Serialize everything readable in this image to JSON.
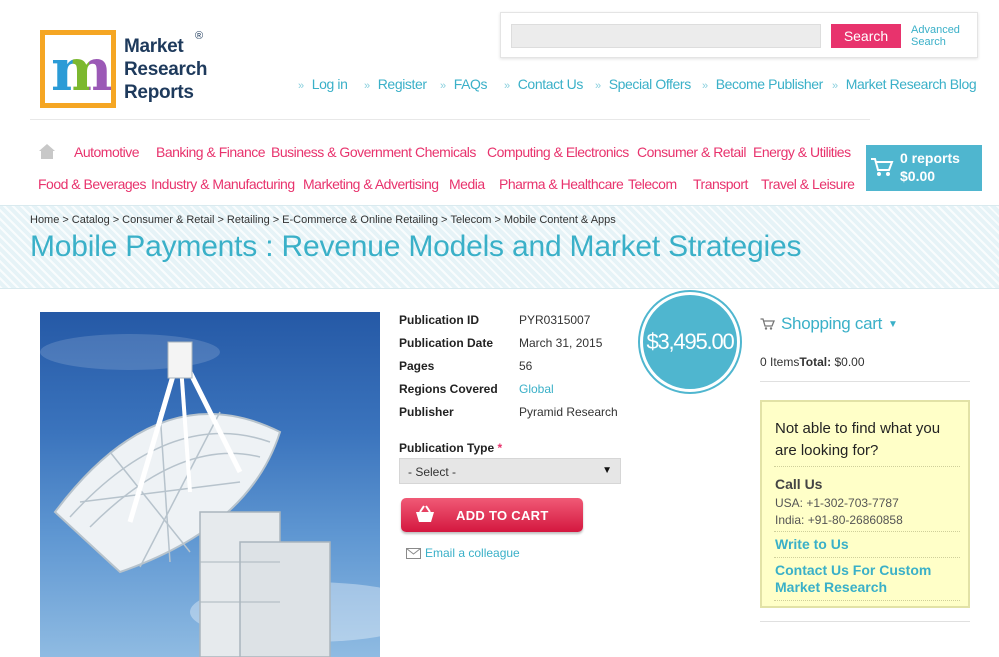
{
  "brand": {
    "line1": "Market",
    "line2": "Research",
    "line3": "Reports",
    "reg": "®",
    "logo_letter": "m"
  },
  "search": {
    "placeholder": "",
    "button": "Search",
    "advanced": "Advanced Search"
  },
  "top_links": [
    "Log in",
    "Register",
    "FAQs",
    "Contact Us",
    "Special Offers",
    "Become Publisher",
    "Market Research Blog"
  ],
  "categories_row1": [
    "Automotive",
    "Banking & Finance",
    "Business & Government",
    "Chemicals",
    "Computing & Electronics",
    "Consumer & Retail",
    "Energy & Utilities"
  ],
  "categories_row2": [
    "Food & Beverages",
    "Industry & Manufacturing",
    "Marketing & Advertising",
    "Media",
    "Pharma & Healthcare",
    "Telecom",
    "Transport",
    "Travel & Leisure"
  ],
  "cart": {
    "count": "0 reports",
    "amount": "$0.00"
  },
  "breadcrumb": [
    "Home",
    "Catalog",
    "Consumer & Retail",
    "Retailing",
    "E-Commerce & Online Retailing",
    "Telecom",
    "Mobile Content & Apps"
  ],
  "breadcrumb_sep": ">",
  "title": "Mobile Payments : Revenue Models and Market Strategies",
  "details": [
    {
      "label": "Publication ID",
      "value": "PYR0315007"
    },
    {
      "label": "Publication Date",
      "value": "March 31, 2015"
    },
    {
      "label": "Pages",
      "value": "56"
    },
    {
      "label": "Regions Covered",
      "value": "Global"
    },
    {
      "label": "Publisher",
      "value": "Pyramid Research"
    }
  ],
  "price": "$3,495.00",
  "publication_type": {
    "label": "Publication Type",
    "required_mark": "*",
    "selected": "- Select -"
  },
  "add_to_cart": "ADD TO CART",
  "email_colleague": "Email a colleague",
  "shopping_cart": {
    "heading": "Shopping cart",
    "items": "0 Items",
    "total_label": "Total:",
    "total_value": "$0.00"
  },
  "help": {
    "question": "Not able to find what you are looking for?",
    "call_us": "Call Us",
    "usa": "USA: +1-302-703-7787",
    "india": "India: +91-80-26860858",
    "write_to_us": "Write to Us",
    "contact_custom": "Contact Us For Custom Market Research"
  },
  "colors": {
    "accent_teal": "#3ab0c8",
    "accent_pink": "#e8336d",
    "cart_bg": "#4fb6cf",
    "help_bg": "#ffffc8"
  },
  "icons": [
    "home-icon",
    "cart-icon",
    "basket-icon",
    "envelope-icon",
    "chevron-down-icon",
    "bullet-arrow-icon"
  ]
}
